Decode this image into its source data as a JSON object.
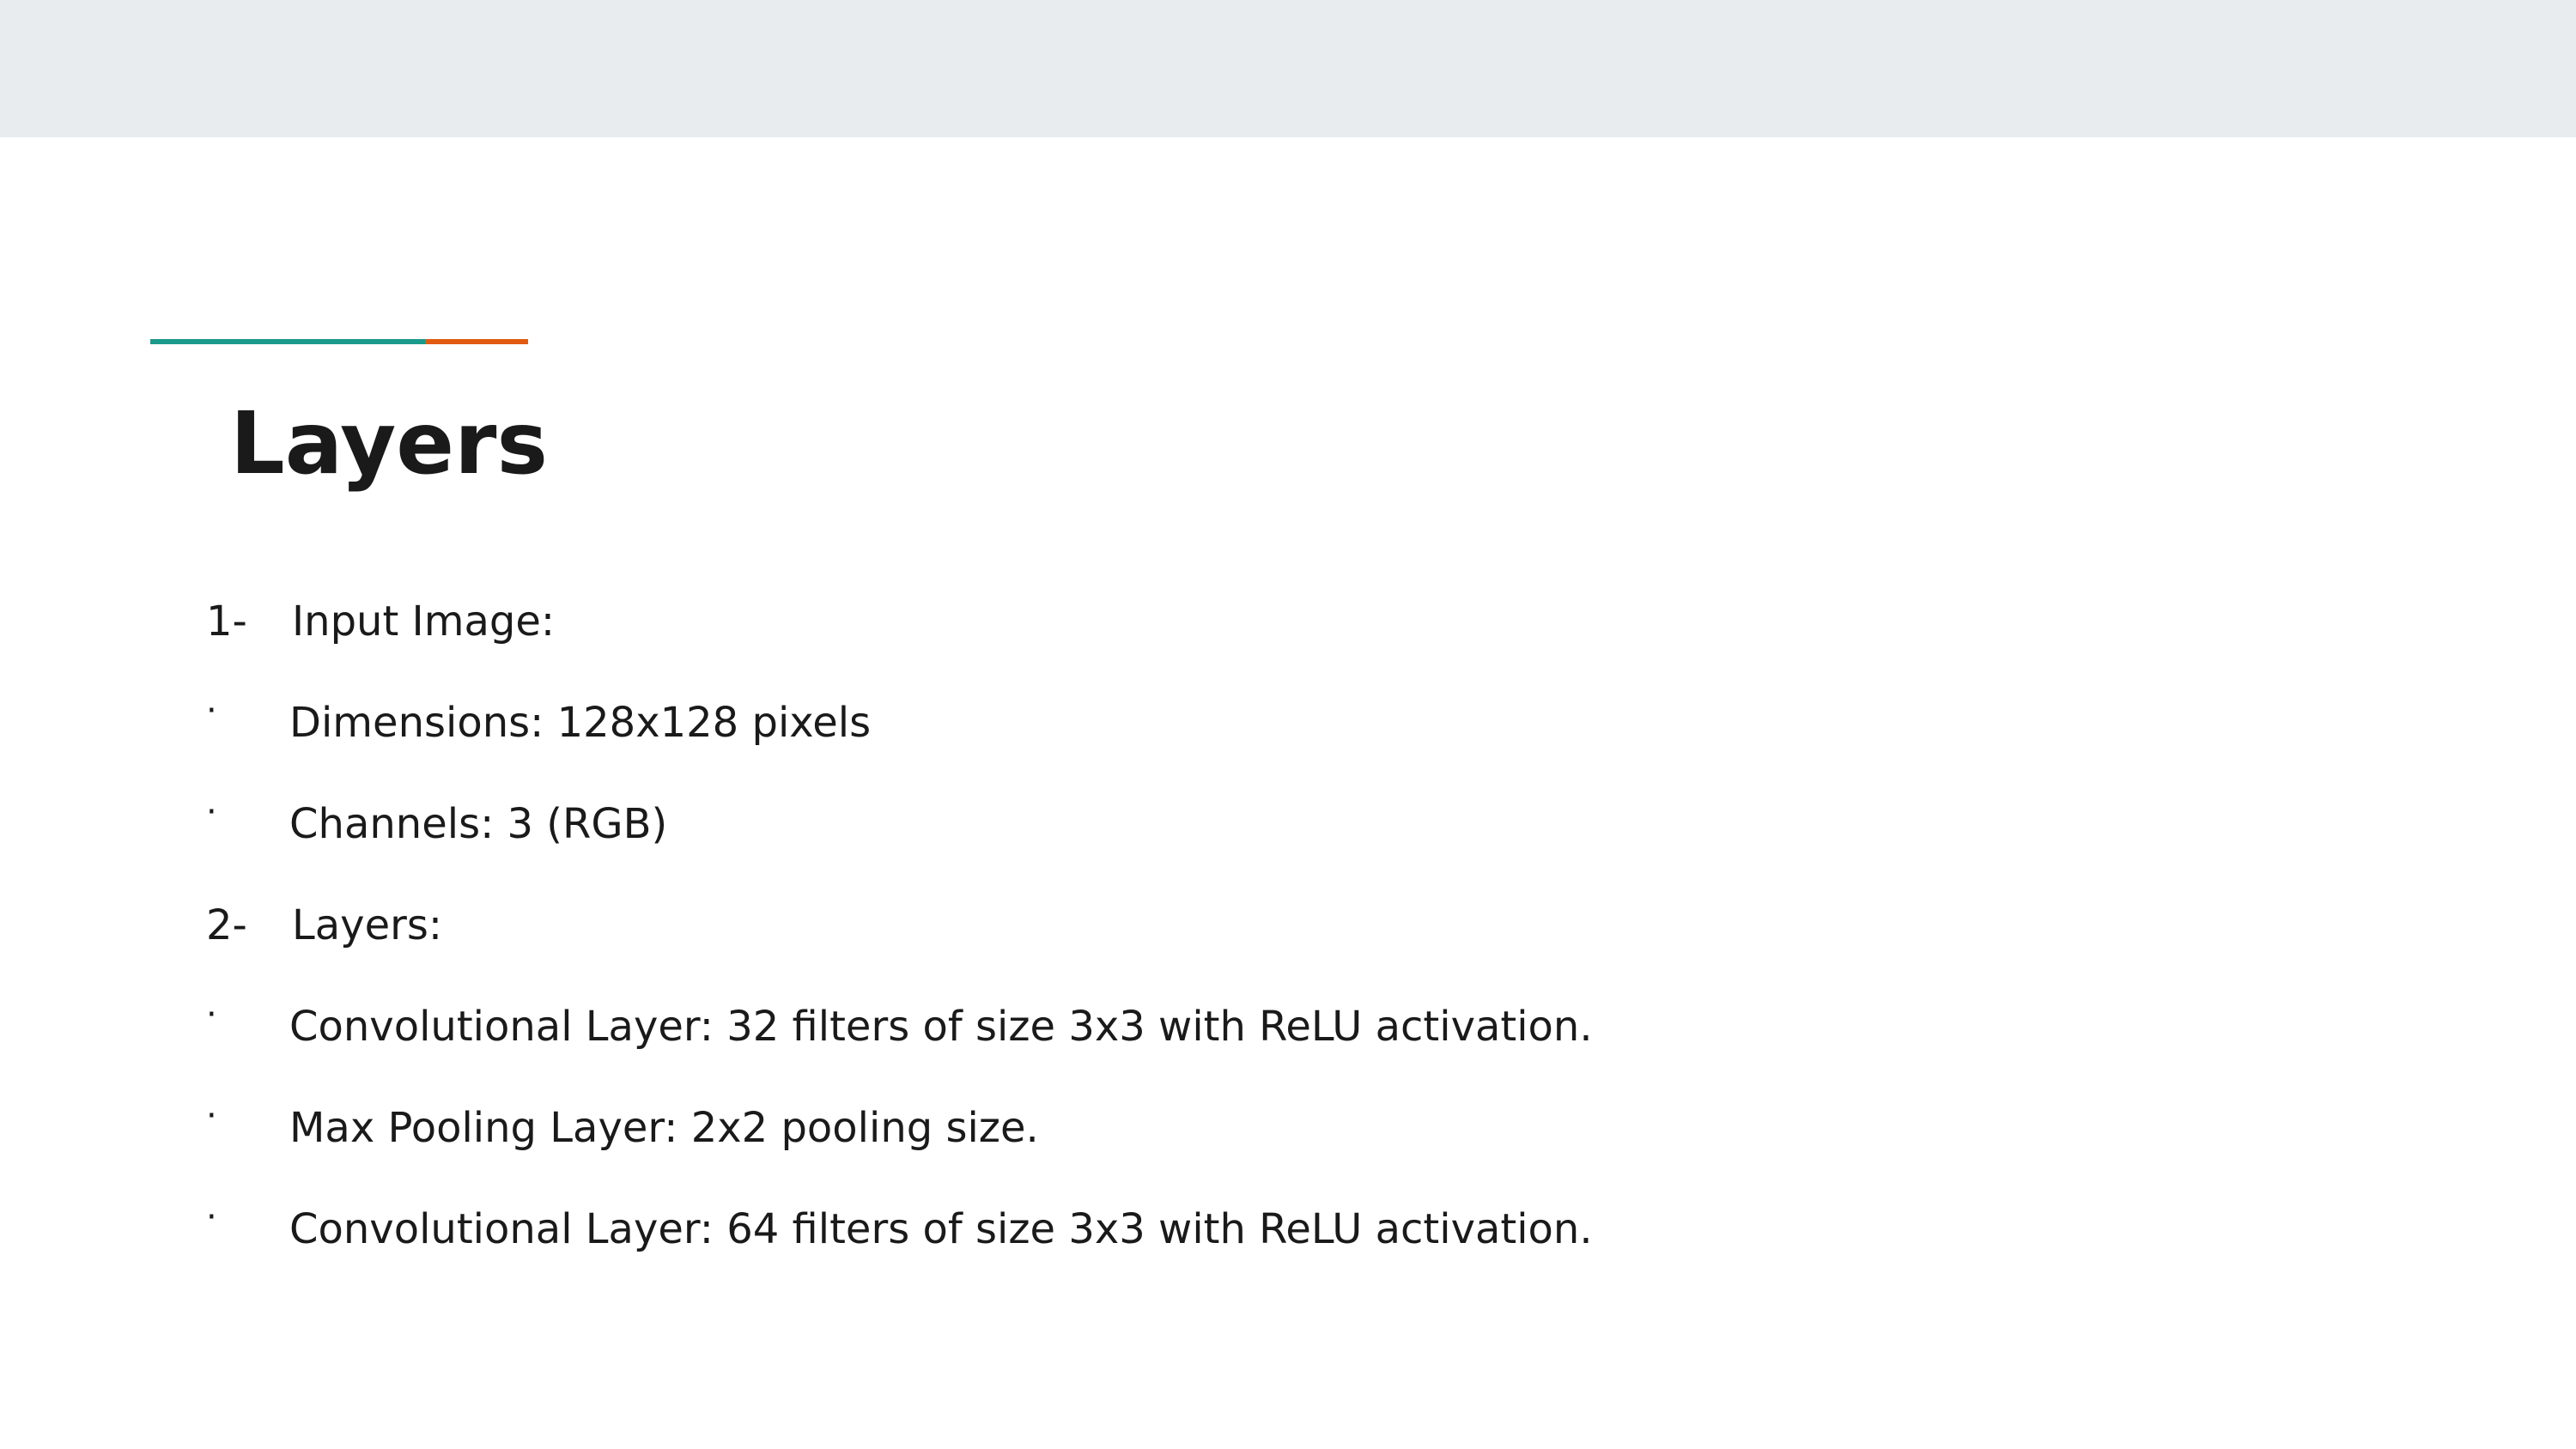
{
  "colors": {
    "top_band": "#e8ecee",
    "accent_teal": "#1a9a8a",
    "accent_orange": "#e05a12",
    "text": "#1a1a1a"
  },
  "title": "Layers",
  "items": [
    {
      "marker": "1-",
      "text": "Input Image:",
      "kind": "number"
    },
    {
      "marker": "·",
      "text": "Dimensions: 128x128 pixels",
      "kind": "bullet"
    },
    {
      "marker": "·",
      "text": "Channels: 3 (RGB)",
      "kind": "bullet"
    },
    {
      "marker": "2-",
      "text": "Layers:",
      "kind": "number"
    },
    {
      "marker": "·",
      "text": "Convolutional Layer: 32 filters of size 3x3 with ReLU activation.",
      "kind": "bullet"
    },
    {
      "marker": "·",
      "text": "Max Pooling Layer: 2x2 pooling size.",
      "kind": "bullet"
    },
    {
      "marker": "·",
      "text": "Convolutional Layer: 64 filters of size 3x3 with ReLU activation.",
      "kind": "bullet"
    }
  ]
}
